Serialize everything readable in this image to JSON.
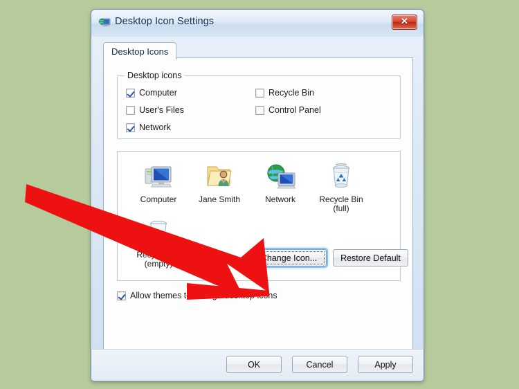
{
  "window": {
    "title": "Desktop Icon Settings",
    "title_icon": "monitor-globe-icon",
    "close_label": "✕",
    "close_icon": "close-icon"
  },
  "tabs": [
    {
      "label": "Desktop Icons",
      "selected": true
    }
  ],
  "group": {
    "legend": "Desktop icons",
    "checkboxes": [
      {
        "label": "Computer",
        "checked": true,
        "col": 0,
        "row": 0
      },
      {
        "label": "User's Files",
        "checked": false,
        "col": 0,
        "row": 1
      },
      {
        "label": "Network",
        "checked": true,
        "col": 0,
        "row": 2
      },
      {
        "label": "Recycle Bin",
        "checked": false,
        "col": 1,
        "row": 0
      },
      {
        "label": "Control Panel",
        "checked": false,
        "col": 1,
        "row": 1
      }
    ]
  },
  "preview": {
    "icons": [
      {
        "label": "Computer",
        "label2": "",
        "art": "computer-icon"
      },
      {
        "label": "Jane Smith",
        "label2": "",
        "art": "user-folder-icon"
      },
      {
        "label": "Network",
        "label2": "",
        "art": "network-globe-icon"
      },
      {
        "label": "Recycle Bin",
        "label2": "(full)",
        "art": "recycle-bin-full-icon"
      },
      {
        "label": "Recycle Bin",
        "label2": "(empty)",
        "art": "recycle-bin-empty-icon"
      }
    ]
  },
  "buttons": {
    "change_icon": "Change Icon...",
    "restore_default": "Restore Default",
    "ok": "OK",
    "cancel": "Cancel",
    "apply": "Apply"
  },
  "allow_themes": {
    "label": "Allow themes to change desktop icons",
    "checked": true
  },
  "annotation": {
    "type": "red-arrow",
    "color": "#ee1111",
    "points_to": "Change Icon...",
    "from": [
      38,
      270
    ],
    "to": [
      388,
      424
    ]
  },
  "colors": {
    "desktop_background": "#b6cb9c",
    "accent": "#2a55a5",
    "close_button": "#d9452f",
    "arrow": "#ee1111"
  }
}
